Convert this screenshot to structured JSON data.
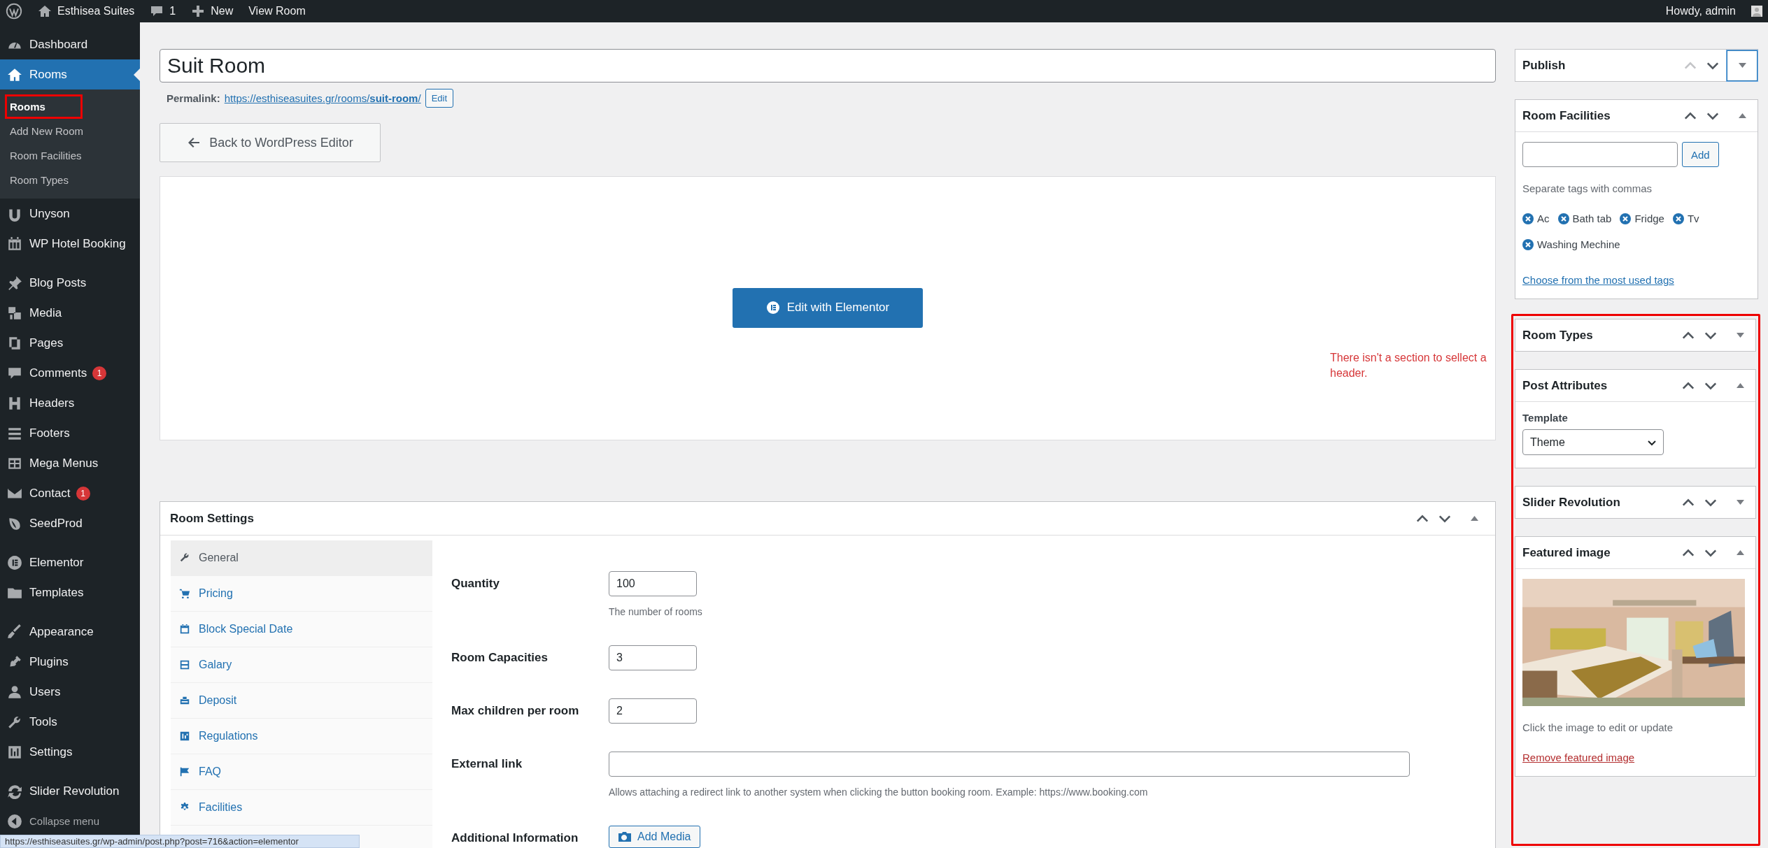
{
  "admin_bar": {
    "site_name": "Esthisea Suites",
    "comments_count": "1",
    "new_label": "New",
    "view_label": "View Room",
    "greeting": "Howdy, admin"
  },
  "sidebar": {
    "groups": [
      [
        {
          "label": "Dashboard",
          "selected": false
        },
        {
          "label": "Rooms",
          "selected": true,
          "children": [
            {
              "label": "Rooms",
              "selected": true,
              "highlighted": true
            },
            {
              "label": "Add New Room",
              "selected": false,
              "highlighted": false
            },
            {
              "label": "Room Facilities",
              "selected": false,
              "highlighted": false
            },
            {
              "label": "Room Types",
              "selected": false,
              "highlighted": false
            }
          ]
        },
        {
          "label": "Unyson",
          "selected": false
        },
        {
          "label": "WP Hotel Booking",
          "selected": false
        }
      ],
      [
        {
          "label": "Blog Posts",
          "selected": false
        },
        {
          "label": "Media",
          "selected": false
        },
        {
          "label": "Pages",
          "selected": false
        },
        {
          "label": "Comments",
          "selected": false,
          "badge": "1"
        },
        {
          "label": "Headers",
          "selected": false
        },
        {
          "label": "Footers",
          "selected": false
        },
        {
          "label": "Mega Menus",
          "selected": false
        },
        {
          "label": "Contact",
          "selected": false,
          "badge": "1"
        },
        {
          "label": "SeedProd",
          "selected": false
        }
      ],
      [
        {
          "label": "Elementor",
          "selected": false
        },
        {
          "label": "Templates",
          "selected": false
        }
      ],
      [
        {
          "label": "Appearance",
          "selected": false
        },
        {
          "label": "Plugins",
          "selected": false
        },
        {
          "label": "Users",
          "selected": false
        },
        {
          "label": "Tools",
          "selected": false
        },
        {
          "label": "Settings",
          "selected": false
        }
      ],
      [
        {
          "label": "Slider Revolution",
          "selected": false
        }
      ]
    ],
    "collapse_label": "Collapse menu"
  },
  "editor": {
    "title": "Suit Room",
    "permalink_label": "Permalink:",
    "permalink_base": "https://esthiseasuites.gr/rooms/",
    "permalink_slug": "suit-room",
    "permalink_end": "/",
    "permalink_edit": "Edit",
    "back_button": "Back to WordPress Editor",
    "elementor_button": "Edit with Elementor",
    "annotation": "There isn't a section to sellect a header."
  },
  "room_settings": {
    "title": "Room Settings",
    "tabs": [
      {
        "label": "General",
        "selected": true
      },
      {
        "label": "Pricing",
        "selected": false
      },
      {
        "label": "Block Special Date",
        "selected": false
      },
      {
        "label": "Galary",
        "selected": false
      },
      {
        "label": "Deposit",
        "selected": false
      },
      {
        "label": "Regulations",
        "selected": false
      },
      {
        "label": "FAQ",
        "selected": false
      },
      {
        "label": "Facilities",
        "selected": false
      }
    ],
    "fields": [
      {
        "kind": "number",
        "label": "Quantity",
        "value": "100",
        "help": "The number of rooms"
      },
      {
        "kind": "number",
        "label": "Room Capacities",
        "value": "3"
      },
      {
        "kind": "number",
        "label": "Max children per room",
        "value": "2"
      },
      {
        "kind": "text",
        "label": "External link",
        "help": "Allows attaching a redirect link to another system when clicking the button booking room. Example: https://www.booking.com"
      },
      {
        "kind": "editor",
        "label": "Additional Information",
        "button": "Add Media"
      }
    ]
  },
  "right_column": {
    "boxes": [
      {
        "title": "Publish",
        "expanded": false,
        "focused": true,
        "move_up_disabled": true
      },
      {
        "kind": "tags",
        "title": "Room Facilities",
        "expanded": true,
        "focused": false,
        "move_up_disabled": false,
        "add_button": "Add",
        "hint": "Separate tags with commas",
        "tags": [
          "Ac",
          "Bath tab",
          "Fridge",
          "Tv",
          "Washing Mechine"
        ],
        "link": "Choose from the most used tags"
      }
    ],
    "marked_group": {
      "boxes": [
        {
          "title": "Room Types",
          "expanded": false,
          "focused": false,
          "move_up_disabled": false
        },
        {
          "kind": "attributes",
          "title": "Post Attributes",
          "expanded": true,
          "focused": false,
          "move_up_disabled": false,
          "select_label": "Template",
          "select_value": "Theme"
        },
        {
          "title": "Slider Revolution",
          "expanded": false,
          "focused": false,
          "move_up_disabled": false
        },
        {
          "kind": "featured",
          "title": "Featured image",
          "expanded": true,
          "focused": false,
          "move_up_disabled": false,
          "caption": "Click the image to edit or update",
          "link": "Remove featured image"
        }
      ]
    }
  },
  "status_url": "https://esthiseasuites.gr/wp-admin/post.php?post=716&action=elementor"
}
